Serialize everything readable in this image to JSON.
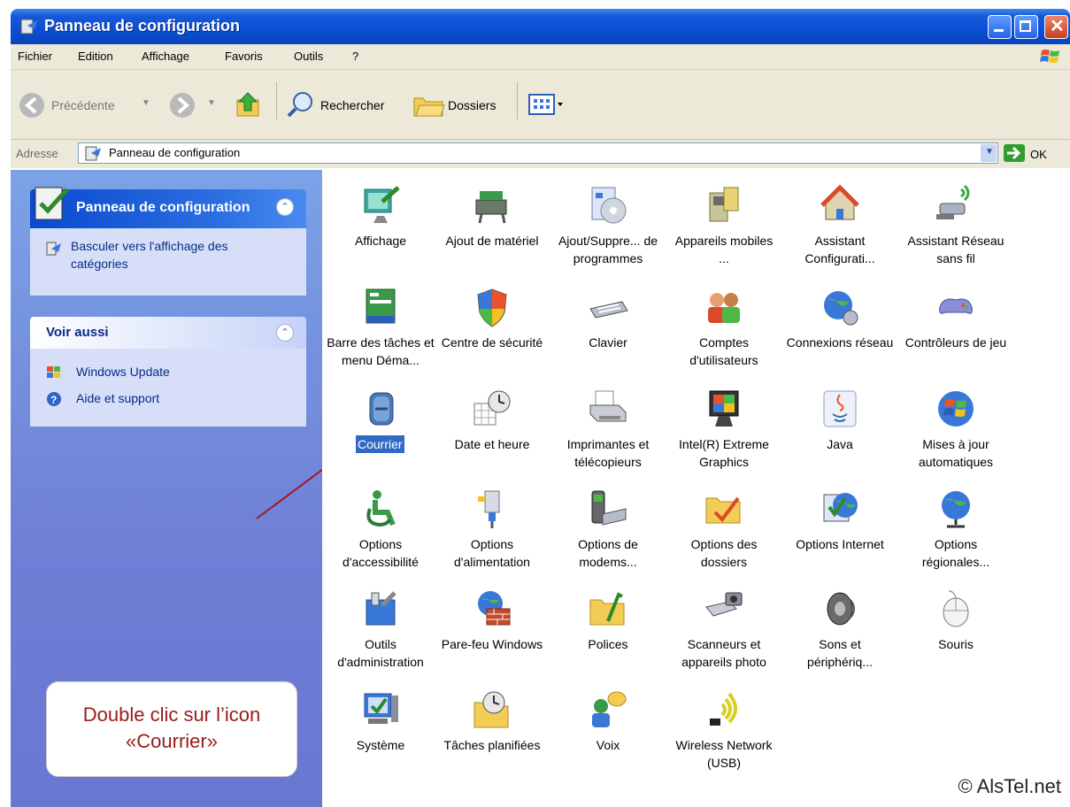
{
  "window": {
    "title": "Panneau de configuration"
  },
  "menubar": [
    "Fichier",
    "Edition",
    "Affichage",
    "Favoris",
    "Outils",
    "?"
  ],
  "toolbar": {
    "back": "Précédente",
    "search": "Rechercher",
    "folders": "Dossiers"
  },
  "address": {
    "label": "Adresse",
    "value": "Panneau de configuration",
    "go": "OK"
  },
  "sidebar": {
    "panel_title": "Panneau de configuration",
    "switch_link": "Basculer vers l'affichage des catégories",
    "see_also_title": "Voir aussi",
    "see_also": [
      "Windows Update",
      "Aide et support"
    ]
  },
  "callout": {
    "line1": "Double clic sur l’icon",
    "line2": "«Courrier»"
  },
  "items": [
    {
      "label": "Affichage",
      "icon": "display-icon"
    },
    {
      "label": "Ajout de matériel",
      "icon": "add-hardware-icon"
    },
    {
      "label": "Ajout/Suppre... de programmes",
      "icon": "add-remove-programs-icon"
    },
    {
      "label": "Appareils mobiles ...",
      "icon": "mobile-devices-icon"
    },
    {
      "label": "Assistant Configurati...",
      "icon": "home-network-icon"
    },
    {
      "label": "Assistant Réseau sans fil",
      "icon": "wireless-wizard-icon"
    },
    {
      "label": "Barre des tâches et menu Déma...",
      "icon": "taskbar-icon"
    },
    {
      "label": "Centre de sécurité",
      "icon": "security-shield-icon"
    },
    {
      "label": "Clavier",
      "icon": "keyboard-icon"
    },
    {
      "label": "Comptes d'utilisateurs",
      "icon": "user-accounts-icon"
    },
    {
      "label": "Connexions réseau",
      "icon": "network-globe-icon"
    },
    {
      "label": "Contrôleurs de jeu",
      "icon": "game-controller-icon"
    },
    {
      "label": "Courrier",
      "icon": "mail-icon",
      "selected": true
    },
    {
      "label": "Date et heure",
      "icon": "date-time-icon"
    },
    {
      "label": "Imprimantes et télécopieurs",
      "icon": "printer-icon"
    },
    {
      "label": "Intel(R) Extreme Graphics",
      "icon": "intel-graphics-icon"
    },
    {
      "label": "Java",
      "icon": "java-icon"
    },
    {
      "label": "Mises à jour automatiques",
      "icon": "windows-update-icon"
    },
    {
      "label": "Options d'accessibilité",
      "icon": "accessibility-icon"
    },
    {
      "label": "Options d'alimentation",
      "icon": "power-plug-icon"
    },
    {
      "label": "Options de modems...",
      "icon": "modem-phone-icon"
    },
    {
      "label": "Options des dossiers",
      "icon": "folder-options-icon"
    },
    {
      "label": "Options Internet",
      "icon": "internet-options-icon"
    },
    {
      "label": "Options régionales...",
      "icon": "regional-globe-icon"
    },
    {
      "label": "Outils d'administration",
      "icon": "admin-tools-icon"
    },
    {
      "label": "Pare-feu Windows",
      "icon": "firewall-icon"
    },
    {
      "label": "Polices",
      "icon": "fonts-folder-icon"
    },
    {
      "label": "Scanneurs et appareils photo",
      "icon": "scanner-camera-icon"
    },
    {
      "label": "Sons et périphériq...",
      "icon": "speaker-icon"
    },
    {
      "label": "Souris",
      "icon": "mouse-icon"
    },
    {
      "label": "Système",
      "icon": "system-icon"
    },
    {
      "label": "Tâches planifiées",
      "icon": "scheduled-tasks-icon"
    },
    {
      "label": "Voix",
      "icon": "speech-icon"
    },
    {
      "label": "Wireless Network (USB)",
      "icon": "wireless-usb-icon"
    }
  ],
  "watermark": "© AlsTel.net",
  "colors": {
    "titlebar": "#0b4fd6",
    "sidebar": "#6f7fd6",
    "selection": "#316ac5",
    "callout_text": "#9b1a1a"
  }
}
